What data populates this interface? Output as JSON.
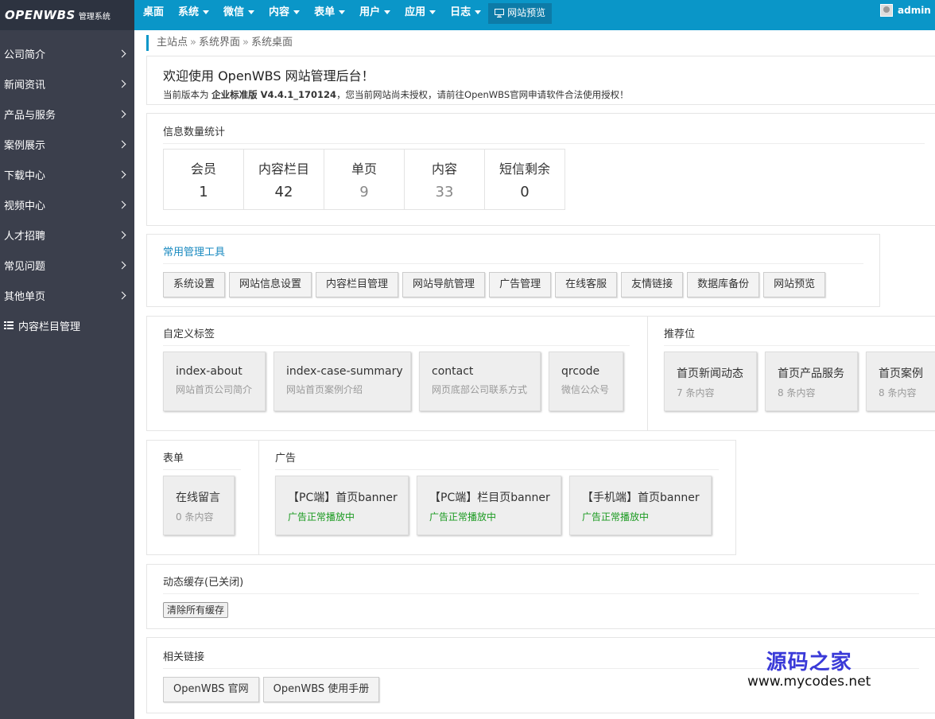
{
  "logo": {
    "brand": "OPENWBS",
    "subtitle": "管理系统"
  },
  "nav": {
    "items": [
      {
        "label": "桌面",
        "dropdown": false
      },
      {
        "label": "系统",
        "dropdown": true
      },
      {
        "label": "微信",
        "dropdown": true
      },
      {
        "label": "内容",
        "dropdown": true
      },
      {
        "label": "表单",
        "dropdown": true
      },
      {
        "label": "用户",
        "dropdown": true
      },
      {
        "label": "应用",
        "dropdown": true
      },
      {
        "label": "日志",
        "dropdown": true
      }
    ],
    "preview_label": "网站预览",
    "user": "admin (管"
  },
  "sidebar": {
    "items": [
      {
        "label": "公司简介"
      },
      {
        "label": "新闻资讯"
      },
      {
        "label": "产品与服务"
      },
      {
        "label": "案例展示"
      },
      {
        "label": "下载中心"
      },
      {
        "label": "视频中心"
      },
      {
        "label": "人才招聘"
      },
      {
        "label": "常见问题"
      },
      {
        "label": "其他单页"
      }
    ],
    "column_manage": "内容栏目管理"
  },
  "breadcrumb": [
    "主站点",
    "系统界面",
    "系统桌面"
  ],
  "welcome": {
    "title": "欢迎使用 OpenWBS 网站管理后台！",
    "text_prefix": "当前版本为 ",
    "edition": "企业标准版 V4.4.1_170124",
    "text_suffix": "，您当前网站尚未授权，请前往OpenWBS官网申请软件合法使用授权！"
  },
  "stats": {
    "title": "信息数量统计",
    "items": [
      {
        "label": "会员",
        "value": "1"
      },
      {
        "label": "内容栏目",
        "value": "42"
      },
      {
        "label": "单页",
        "value": "9"
      },
      {
        "label": "内容",
        "value": "33"
      },
      {
        "label": "短信剩余",
        "value": "0"
      }
    ]
  },
  "tools": {
    "title": "常用管理工具",
    "title_color": "#1a8ac0",
    "buttons": [
      "系统设置",
      "网站信息设置",
      "内容栏目管理",
      "网站导航管理",
      "广告管理",
      "在线客服",
      "友情链接",
      "数据库备份",
      "网站预览"
    ]
  },
  "custom_tags": {
    "title": "自定义标签",
    "items": [
      {
        "name": "index-about",
        "desc": "网站首页公司简介"
      },
      {
        "name": "index-case-summary",
        "desc": "网站首页案例介绍"
      },
      {
        "name": "contact",
        "desc": "网页底部公司联系方式"
      },
      {
        "name": "qrcode",
        "desc": "微信公众号"
      }
    ]
  },
  "recommend": {
    "title": "推荐位",
    "items": [
      {
        "name": "首页新闻动态",
        "desc": "7 条内容"
      },
      {
        "name": "首页产品服务",
        "desc": "8 条内容"
      },
      {
        "name": "首页案例",
        "desc": "8 条内容"
      }
    ]
  },
  "forms": {
    "title": "表单",
    "items": [
      {
        "name": "在线留言",
        "desc": "0 条内容"
      }
    ]
  },
  "ads": {
    "title": "广告",
    "status_color": "#1a9a20",
    "items": [
      {
        "name": "【PC端】首页banner",
        "status": "广告正常播放中"
      },
      {
        "name": "【PC端】栏目页banner",
        "status": "广告正常播放中"
      },
      {
        "name": "【手机端】首页banner",
        "status": "广告正常播放中"
      }
    ]
  },
  "cache": {
    "title": "动态缓存(已关闭)",
    "clear_label": "清除所有缓存"
  },
  "links": {
    "title": "相关链接",
    "buttons": [
      "OpenWBS 官网",
      "OpenWBS 使用手册"
    ]
  },
  "watermark": {
    "line1": "源码之家",
    "line2": "www.mycodes.net"
  }
}
